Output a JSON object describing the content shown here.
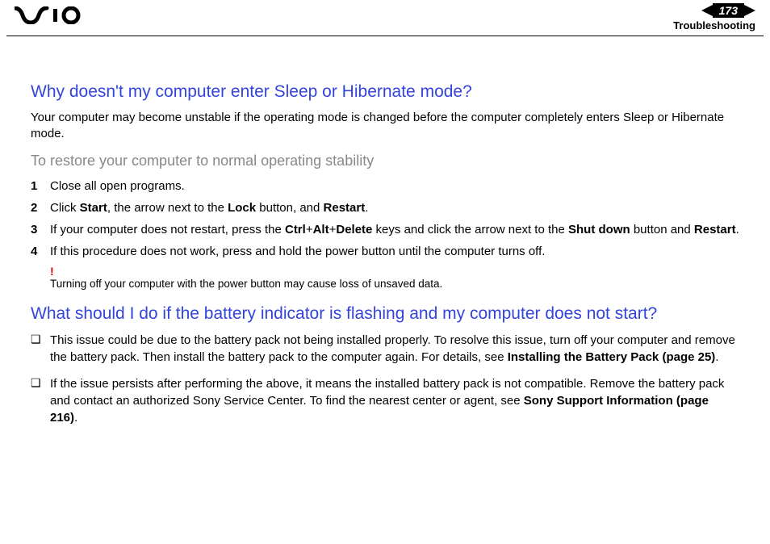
{
  "header": {
    "page_number": "173",
    "section": "Troubleshooting"
  },
  "q1": {
    "title": "Why doesn't my computer enter Sleep or Hibernate mode?",
    "intro": "Your computer may become unstable if the operating mode is changed before the computer completely enters Sleep or Hibernate mode.",
    "subhead": "To restore your computer to normal operating stability",
    "steps": [
      {
        "n": "1",
        "t1": "Close all open programs."
      },
      {
        "n": "2",
        "pre": "Click ",
        "b1": "Start",
        "mid1": ", the arrow next to the ",
        "b2": "Lock",
        "mid2": " button, and ",
        "b3": "Restart",
        "post": "."
      },
      {
        "n": "3",
        "pre": "If your computer does not restart, press the ",
        "b1": "Ctrl",
        "plus1": "+",
        "b2": "Alt",
        "plus2": "+",
        "b3": "Delete",
        "mid": " keys and click the arrow next to the ",
        "b4": "Shut down",
        "mid2": " button and ",
        "b5": "Restart",
        "post": "."
      },
      {
        "n": "4",
        "t1": "If this procedure does not work, press and hold the power button until the computer turns off."
      }
    ],
    "bang": "!",
    "note": "Turning off your computer with the power button may cause loss of unsaved data."
  },
  "q2": {
    "title": "What should I do if the battery indicator is flashing and my computer does not start?",
    "bullets": [
      {
        "pre": "This issue could be due to the battery pack not being installed properly. To resolve this issue, turn off your computer and remove the battery pack. Then install the battery pack to the computer again. For details, see ",
        "b": "Installing the Battery Pack (page 25)",
        "post": "."
      },
      {
        "pre": "If the issue persists after performing the above, it means the installed battery pack is not compatible. Remove the battery pack and contact an authorized Sony Service Center. To find the nearest center or agent, see ",
        "b": "Sony Support Information (page 216)",
        "post": "."
      }
    ]
  },
  "glyphs": {
    "square": "❑"
  }
}
